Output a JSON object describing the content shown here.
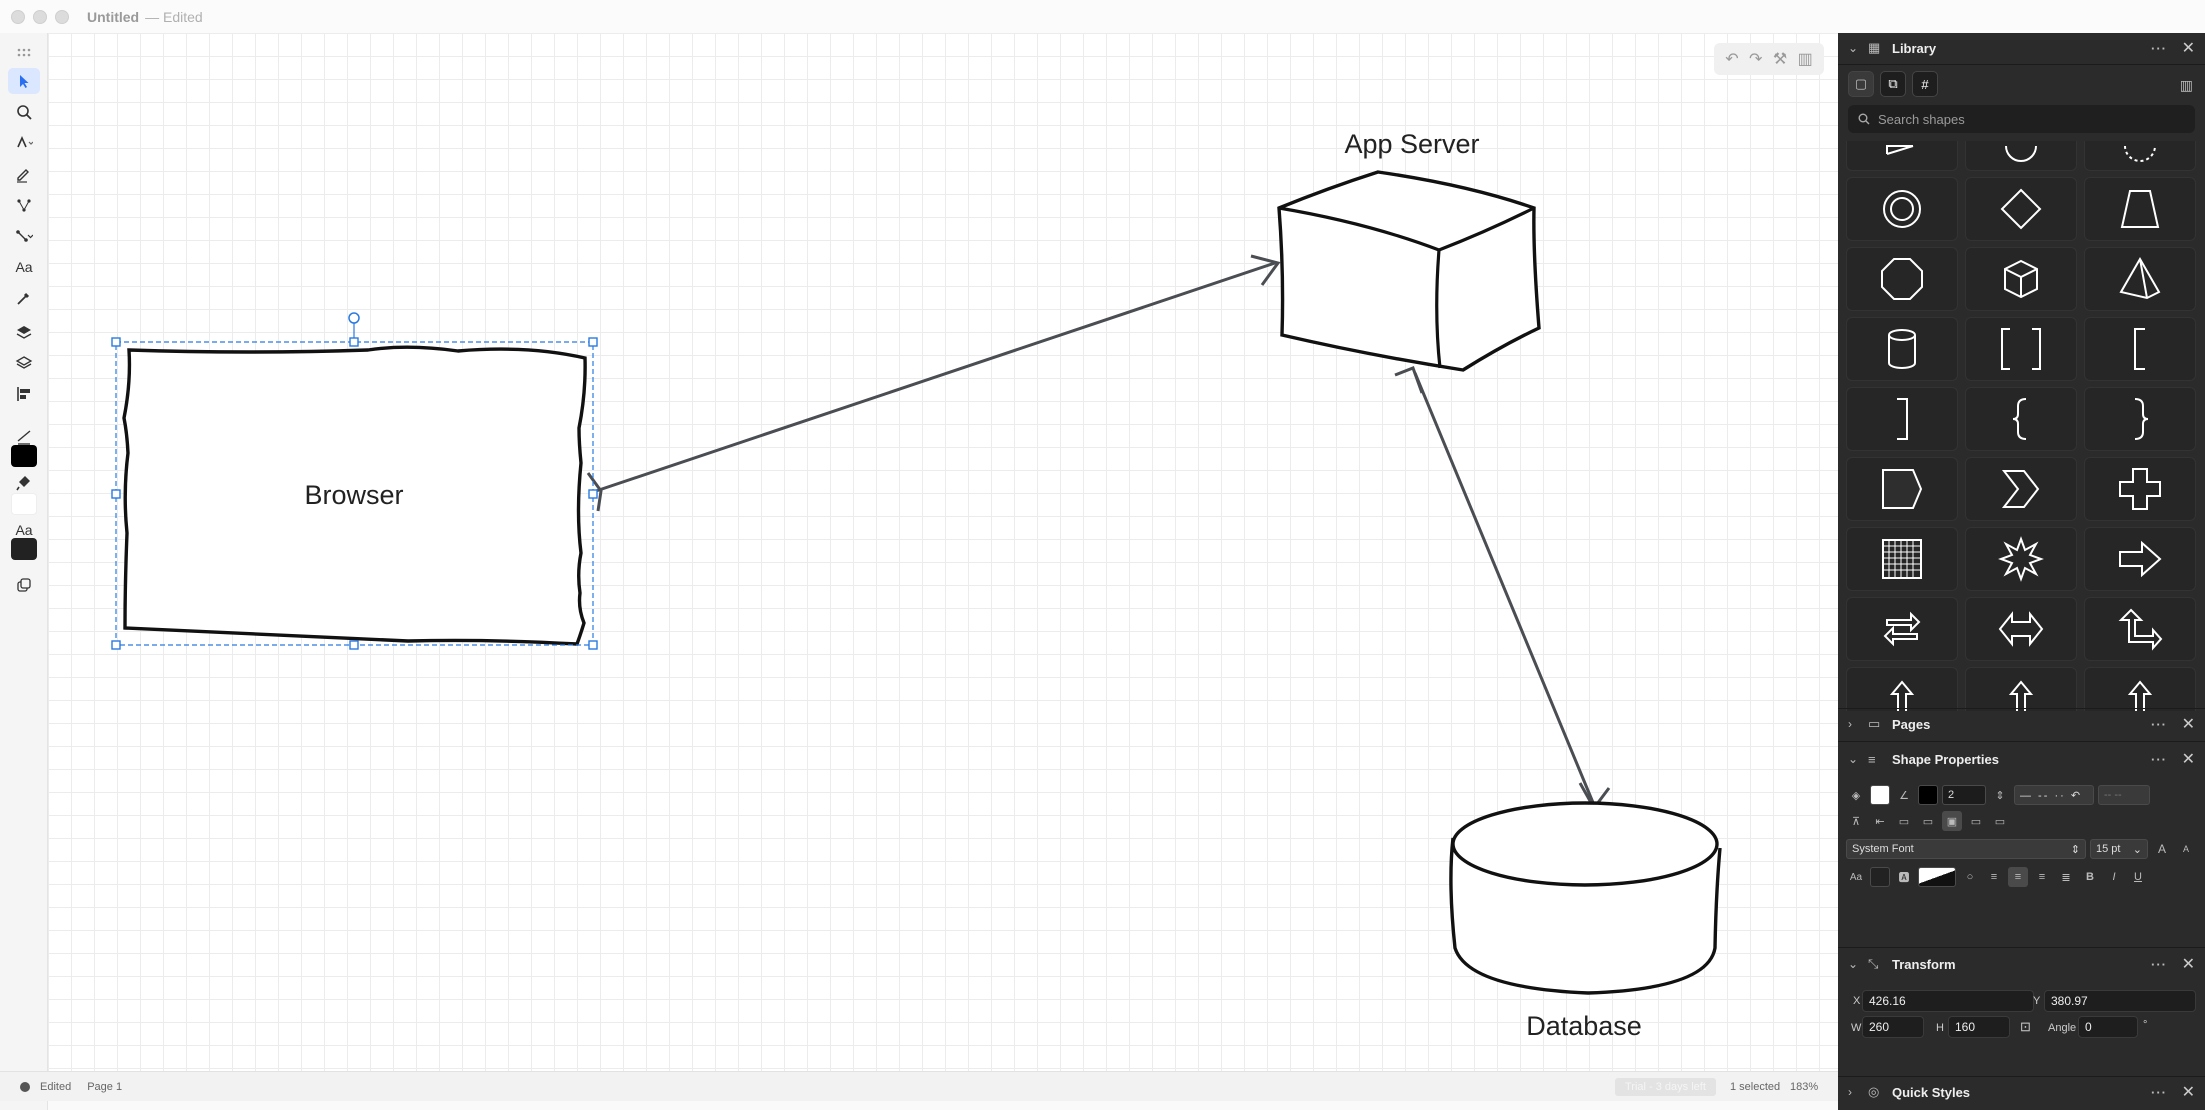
{
  "window": {
    "title": "Untitled",
    "subtitle": "— Edited"
  },
  "canvas": {
    "shapes": [
      {
        "id": "browser",
        "label": "Browser"
      },
      {
        "id": "app-server",
        "label": "App Server"
      },
      {
        "id": "database",
        "label": "Database"
      }
    ],
    "tools": [
      "undo-icon",
      "redo-icon",
      "hammer-icon",
      "sidebar-icon"
    ]
  },
  "toolbar": {
    "text_tool_label": "Aa",
    "text_style_label": "Aa",
    "fill_color": "#000000",
    "stroke_color": "#ffffff",
    "text_color": "#222222"
  },
  "status": {
    "state": "Edited",
    "page": "Page 1",
    "trial": "Trial - 3 days left",
    "selection": "1 selected",
    "zoom": "183%"
  },
  "panels": {
    "library": {
      "title": "Library",
      "search_placeholder": "Search shapes"
    },
    "pages": {
      "title": "Pages"
    },
    "shape_properties": {
      "title": "Shape Properties",
      "line_width": "2",
      "font": "System Font",
      "font_size": "15 pt",
      "font_size_up": "A",
      "font_size_down": "A",
      "text_label": "Aa",
      "bold": "B",
      "italic": "I",
      "underline": "U"
    },
    "transform": {
      "title": "Transform",
      "x_label": "X",
      "x": "426.16",
      "y_label": "Y",
      "y": "380.97",
      "w_label": "W",
      "w": "260",
      "h_label": "H",
      "h": "160",
      "angle_label": "Angle",
      "angle": "0",
      "angle_unit": "°"
    },
    "quick_styles": {
      "title": "Quick Styles"
    }
  }
}
